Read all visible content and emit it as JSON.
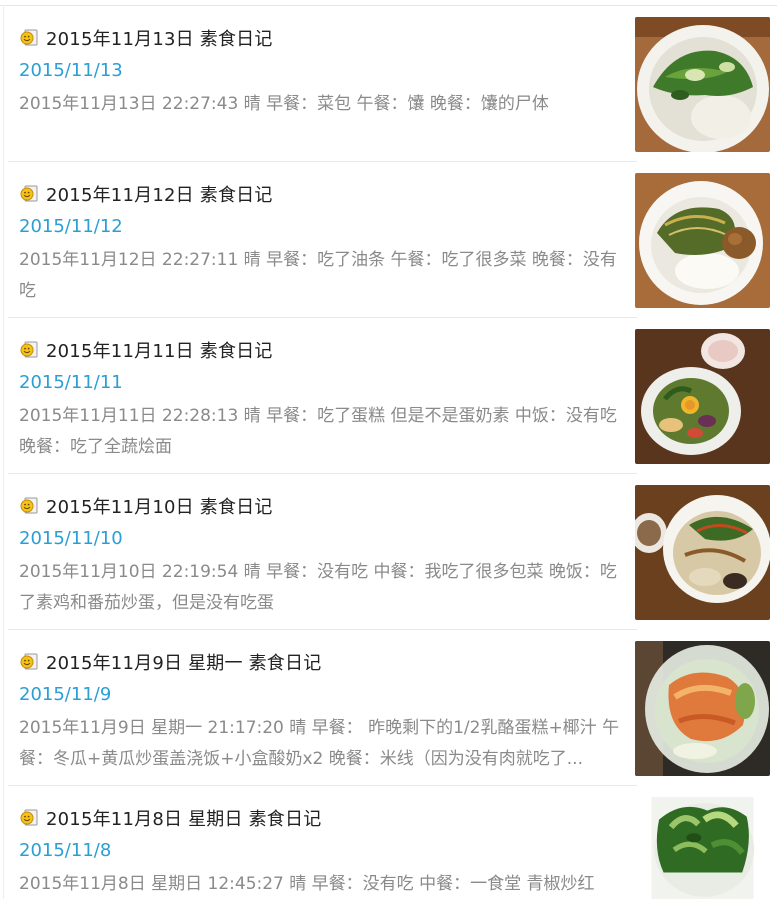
{
  "entries": [
    {
      "title": "2015年11月13日 素食日记",
      "date": "2015/11/13",
      "snippet": "2015年11月13日 22:27:43 晴 早餐：菜包 午餐：馕 晚餐：馕的尸体",
      "thumb_icon": "vegetable-plate-photo"
    },
    {
      "title": "2015年11月12日 素食日记",
      "date": "2015/11/12",
      "snippet": "2015年11月12日 22:27:11 晴 早餐：吃了油条 午餐：吃了很多菜 晚餐：没有吃",
      "thumb_icon": "rice-plate-photo"
    },
    {
      "title": "2015年11月11日 素食日记",
      "date": "2015/11/11",
      "snippet": "2015年11月11日 22:28:13 晴 早餐：吃了蛋糕 但是不是蛋奶素 中饭：没有吃 晚餐：吃了全蔬烩面",
      "thumb_icon": "corn-plate-photo"
    },
    {
      "title": "2015年11月10日 素食日记",
      "date": "2015/11/10",
      "snippet": "2015年11月10日 22:19:54 晴 早餐：没有吃 中餐：我吃了很多包菜 晚饭：吃了素鸡和番茄炒蛋，但是没有吃蛋",
      "thumb_icon": "fried-rice-plate-photo"
    },
    {
      "title": "2015年11月9日 星期一 素食日记",
      "date": "2015/11/9",
      "snippet": "2015年11月9日 星期一 21:17:20 晴 早餐： 昨晚剩下的1/2乳酪蛋糕+椰汁 午餐：冬瓜+黄瓜炒蛋盖浇饭+小盒酸奶x2 晚餐：米线（因为没有肉就吃了...",
      "thumb_icon": "wax-gourd-box-photo"
    },
    {
      "title": "2015年11月8日 星期日 素食日记",
      "date": "2015/11/8",
      "snippet": "2015年11月8日 星期日 12:45:27 晴 早餐：没有吃 中餐：一食堂 青椒炒红",
      "thumb_icon": "green-vegetable-photo"
    }
  ],
  "colors": {
    "title": "#222222",
    "date_link": "#2a9fd6",
    "snippet": "#8a8a8a",
    "divider": "#e9e9e9"
  }
}
